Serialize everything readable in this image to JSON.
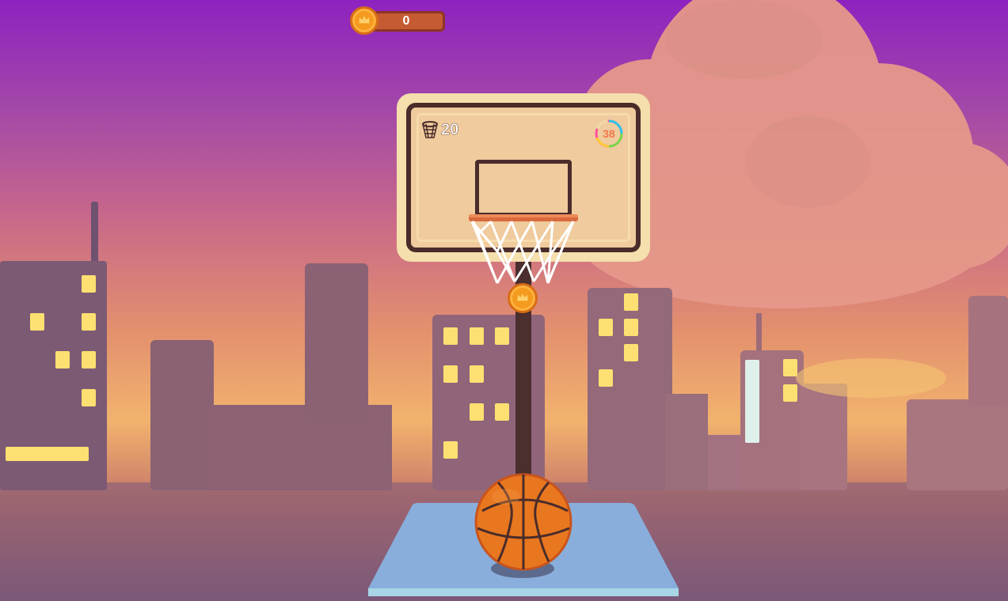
{
  "hud": {
    "coins": "0",
    "coin_icon": "crown-coin-icon"
  },
  "backboard": {
    "shots_icon": "basket-net-icon",
    "shots_remaining": "20",
    "timer_value": "38",
    "timer_progress": 0.8
  },
  "colors": {
    "sky_top": "#8e22c0",
    "sky_bottom": "#f2b36e",
    "ball": "#e8771f",
    "hoop_rim": "#d86a3e",
    "coin": "#f39a1f",
    "platform": "#8bb3da",
    "window": "#fde071"
  }
}
